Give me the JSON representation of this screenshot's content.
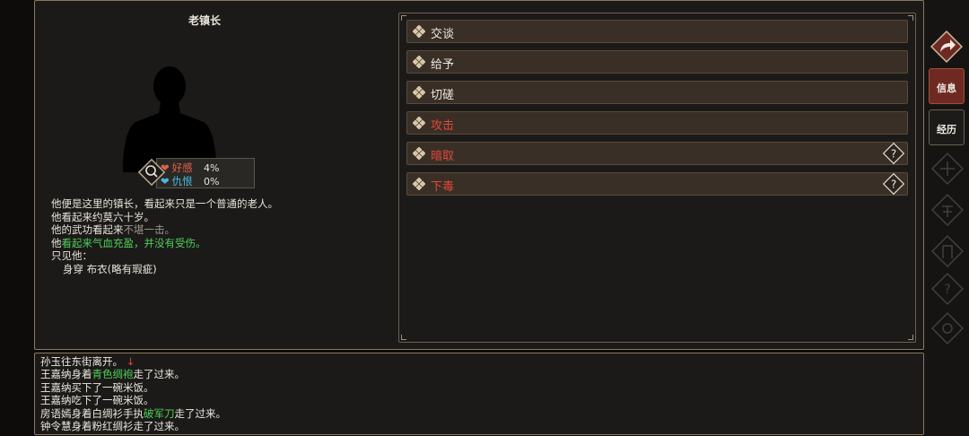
{
  "npc": {
    "name": "老镇长",
    "favor_label": "好感",
    "favor_value": "4%",
    "hatred_label": "仇恨",
    "hatred_value": "0%"
  },
  "description": {
    "line1": "他便是这里的镇长，看起来只是一个普通的老人。",
    "line2": "他看起来约莫六十岁。",
    "line3_prefix": "他的武功看起来",
    "line3_gray": "不堪一击。",
    "line4_prefix": "他",
    "line4_green": "看起来气血充盈，并没有受伤。",
    "line5": "只见他：",
    "line6": "身穿 布衣(略有瑕疵)"
  },
  "actions": [
    {
      "label": "交谈",
      "color": "white",
      "help": false
    },
    {
      "label": "给予",
      "color": "white",
      "help": false
    },
    {
      "label": "切磋",
      "color": "white",
      "help": false
    },
    {
      "label": "攻击",
      "color": "red",
      "help": false
    },
    {
      "label": "暗取",
      "color": "red",
      "help": true
    },
    {
      "label": "下毒",
      "color": "red",
      "help": true
    }
  ],
  "log": {
    "l1": "孙玉往东街离开。",
    "l1_arrow": "↓",
    "l2_a": "王嘉纳身着",
    "l2_g": "青色绸袍",
    "l2_b": "走了过来。",
    "l3": "王嘉纳买下了一碗米饭。",
    "l4": "王嘉纳吃下了一碗米饭。",
    "l5_a": "房语嫣身着白绸衫手执",
    "l5_g": "破军刀",
    "l5_b": "走了过来。",
    "l6": "钟令慧身着粉红绸衫走了过来。"
  },
  "rail": {
    "info_tab": "信息",
    "exp_tab": "经历",
    "ghost_icons": [
      "wu-icon",
      "xue-icon",
      "pai-icon",
      "help-icon",
      "gear-icon"
    ]
  },
  "colors": {
    "accent_red": "#e0483a",
    "accent_green": "#4fcf5a",
    "frame_gold": "#8a7a5e"
  }
}
